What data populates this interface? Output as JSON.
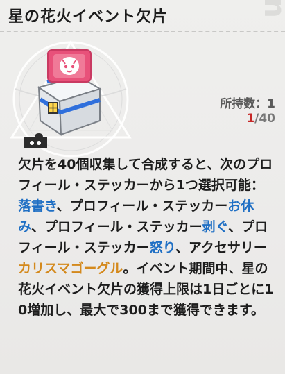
{
  "title": "星の花火イベント欠片",
  "watermark": "icon",
  "quantity_label": "所持数：1",
  "progress": {
    "current": "1",
    "rest": "/40"
  },
  "description": {
    "part1": "欠片を40個収集して合成すると、次のプロフィール・ステッカーから1つ選択可能：",
    "opt1": "落書き",
    "part2": "、プロフィール・ステッカー",
    "opt2": "お休み",
    "part3": "、プロフィール・ステッカー",
    "opt3": "剥ぐ",
    "part4": "、プロフィール・ステッカー",
    "opt4": "怒り",
    "part5": "、アクセサリー",
    "opt5": "カリスマゴーグル",
    "part6": "。イベント期間中、星の花火イベント欠片の獲得上限は1日ごとに10増加し、最大で300まで獲得できます。"
  },
  "colors": {
    "highlight_blue": "#1f6fc4",
    "highlight_orange": "#d4891c",
    "progress_current": "#c62828",
    "sticker_pink": "#e8517a"
  },
  "icons": [
    "item-box-icon",
    "sticker-icon",
    "puzzle-piece-icon"
  ]
}
